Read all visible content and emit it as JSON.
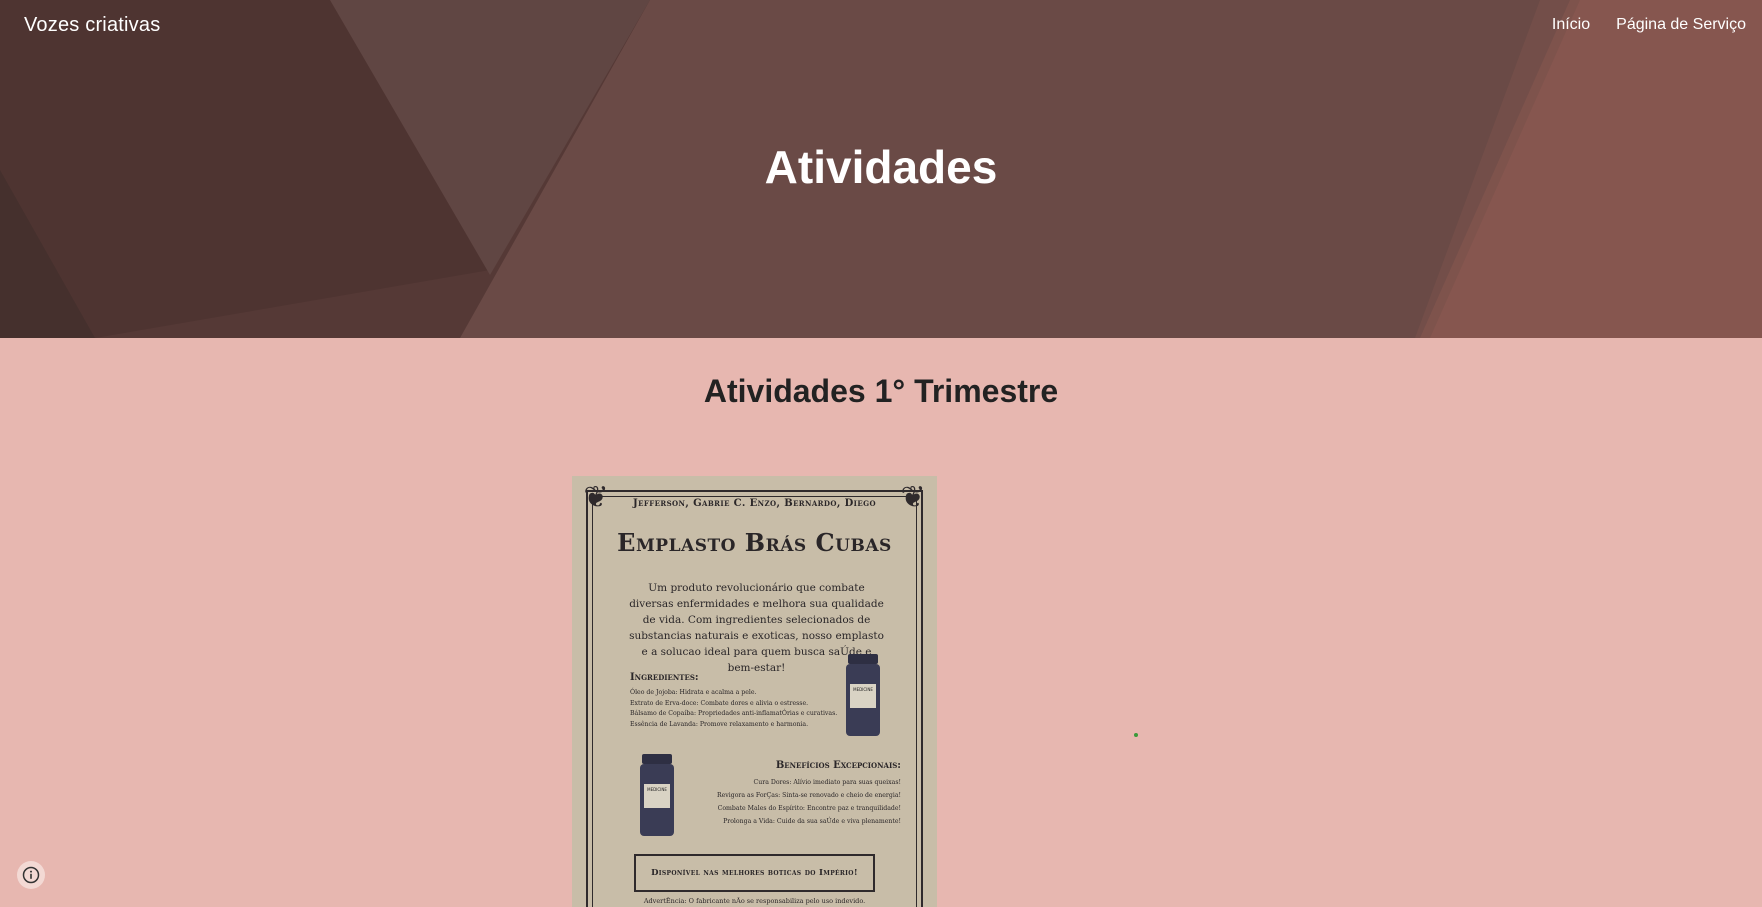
{
  "header": {
    "site_title": "Vozes criativas",
    "nav": [
      {
        "label": "Início"
      },
      {
        "label": "Página de Serviço"
      }
    ],
    "page_title": "Atividades"
  },
  "main": {
    "section_title": "Atividades 1° Trimestre",
    "poster": {
      "authors": "Jefferson, Gabrie C. Enzo, Bernardo, Diego",
      "title": "Emplasto Brás Cubas",
      "description": "Um produto revolucionário que combate diversas enfermidades e melhora sua qualidade de vida. Com ingredientes selecionados de substancias naturais e exoticas, nosso emplasto e a solucao ideal para quem busca saÚde e bem-estar!",
      "ingredients_title": "Ingredientes:",
      "ingredients": [
        "Óleo de Jojoba: Hidrata e acalma a pele.",
        "Extrato de Erva-doce: Combate dores e alivia o estresse.",
        "Bálsamo de Copaíba: Propriedades anti-inflamatÓrias e curativas.",
        "Essência de Lavanda: Promove relaxamento e harmonia."
      ],
      "benefits_title": "Benefícios Excepcionais:",
      "benefits": [
        "Cura Dores: Alívio imediato para suas queixas!",
        "Revigora as ForÇas: Sinta-se renovado e cheio de energia!",
        "Combate Males do Espírito: Encontre paz e tranquilidade!",
        "Prolonga a Vida: Cuide da sua saÚde e viva plenamente!"
      ],
      "bottle_label": "MEDICINE",
      "banner": "Disponível nas melhores boticas do Império!",
      "disclaimer": "AdvertÊncia: O fabricante nÃo se responsabiliza pelo uso indevido."
    }
  },
  "footer": {
    "info_icon": "info-icon"
  },
  "colors": {
    "hero_base": "#6b4a45",
    "page_background": "#e7b7b0",
    "poster_paper": "#c8bda8",
    "ink": "#2a2628"
  }
}
